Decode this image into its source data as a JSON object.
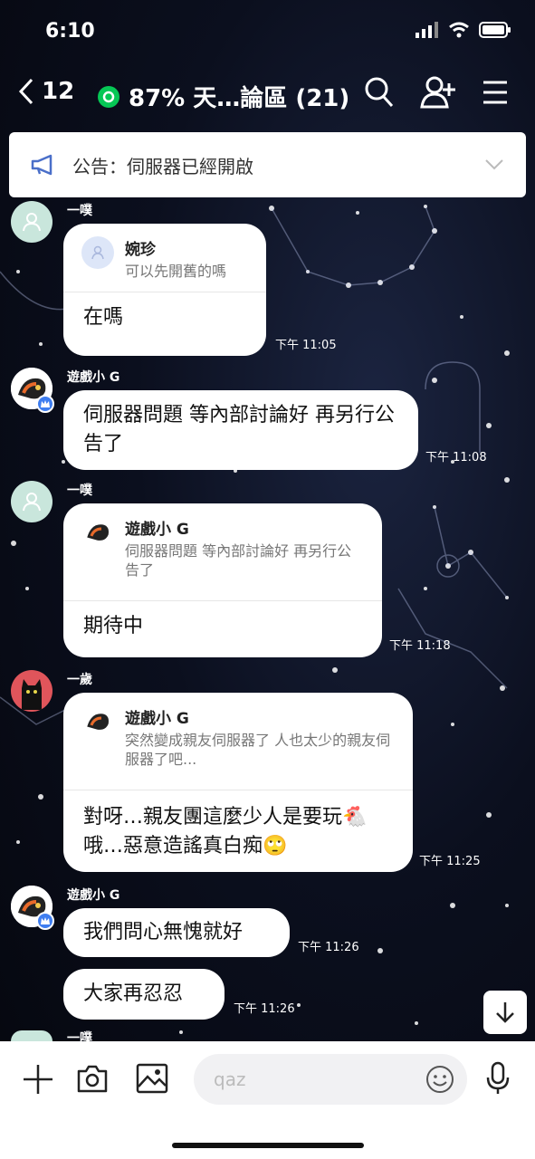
{
  "status_bar": {
    "time": "6:10"
  },
  "header": {
    "back_count": "12",
    "title": "87% 天…論區 (21)"
  },
  "announcement": {
    "text": "公告：伺服器已經開啟"
  },
  "messages": [
    {
      "sender": "一噗",
      "reply_to": {
        "name": "婉珍",
        "text": "可以先開舊的嗎"
      },
      "text": "在嗎",
      "time": "下午 11:05"
    },
    {
      "sender": "遊戲小 G",
      "text": "伺服器問題 等內部討論好 再另行公告了",
      "time": "下午 11:08"
    },
    {
      "sender": "一噗",
      "reply_to": {
        "name": "遊戲小 G",
        "text": "伺服器問題 等內部討論好 再另行公告了"
      },
      "text": "期待中",
      "time": "下午 11:18"
    },
    {
      "sender": "一歲",
      "reply_to": {
        "name": "遊戲小 G",
        "text": "突然變成親友伺服器了 人也太少的親友伺服器了吧..."
      },
      "text": "對呀…親友團這麼少人是要玩🐔哦…惡意造謠真白痴🙄",
      "time": "下午 11:25"
    },
    {
      "sender": "遊戲小 G",
      "text": "我們問心無愧就好",
      "time": "下午 11:26"
    },
    {
      "text": "大家再忍忍",
      "time": "下午 11:26"
    },
    {
      "sender": "一噗"
    }
  ],
  "input": {
    "placeholder": "qaz"
  }
}
